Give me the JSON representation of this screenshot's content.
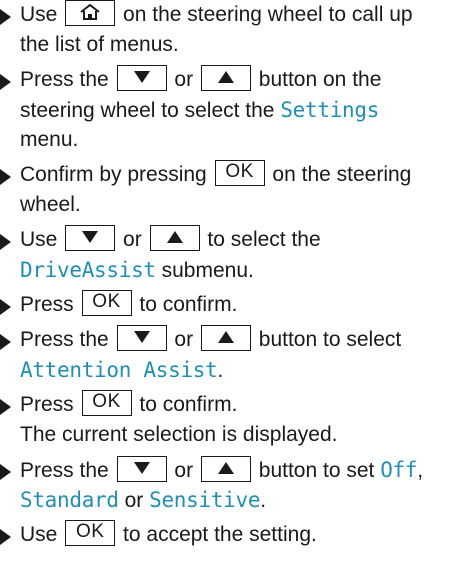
{
  "steps": [
    {
      "line1_pre": "Use",
      "line1_post": "on the steering wheel to call up",
      "line2": "the list of menus."
    },
    {
      "line1_pre": "Press the",
      "or": "or",
      "line1_post": "button on the",
      "line2_pre": "steering wheel to select the",
      "line2_disp": "Settings",
      "line3": "menu."
    },
    {
      "line1_pre": "Confirm by pressing",
      "line1_post": "on the steering",
      "line2": "wheel."
    },
    {
      "line1_pre": "Use",
      "or": "or",
      "line1_post": "to select the",
      "line2_disp": "DriveAssist",
      "line2_post": "submenu."
    },
    {
      "line1_pre": "Press",
      "line1_post": "to confirm."
    },
    {
      "line1_pre": "Press the",
      "or": "or",
      "line1_post": "button to select",
      "line2_disp": "Attention Assist",
      "line2_post": "."
    },
    {
      "line1_pre": "Press",
      "line1_post": "to confirm.",
      "line2": "The current selection is displayed."
    },
    {
      "line1_pre": "Press the",
      "or": "or",
      "line1_post": "button to set",
      "line1_disp": "Off",
      "line1_end": ",",
      "line2_disp1": "Standard",
      "line2_mid": "or",
      "line2_disp2": "Sensitive",
      "line2_end": "."
    },
    {
      "line1_pre": "Use",
      "line1_post": "to accept the setting."
    }
  ],
  "keys": {
    "ok": "OK",
    "home_icon": "home-icon",
    "down_icon": "triangle-down-icon",
    "up_icon": "triangle-up-icon"
  },
  "colors": {
    "display_text": "#1f8fb8",
    "body_text": "#1a1a1a"
  }
}
